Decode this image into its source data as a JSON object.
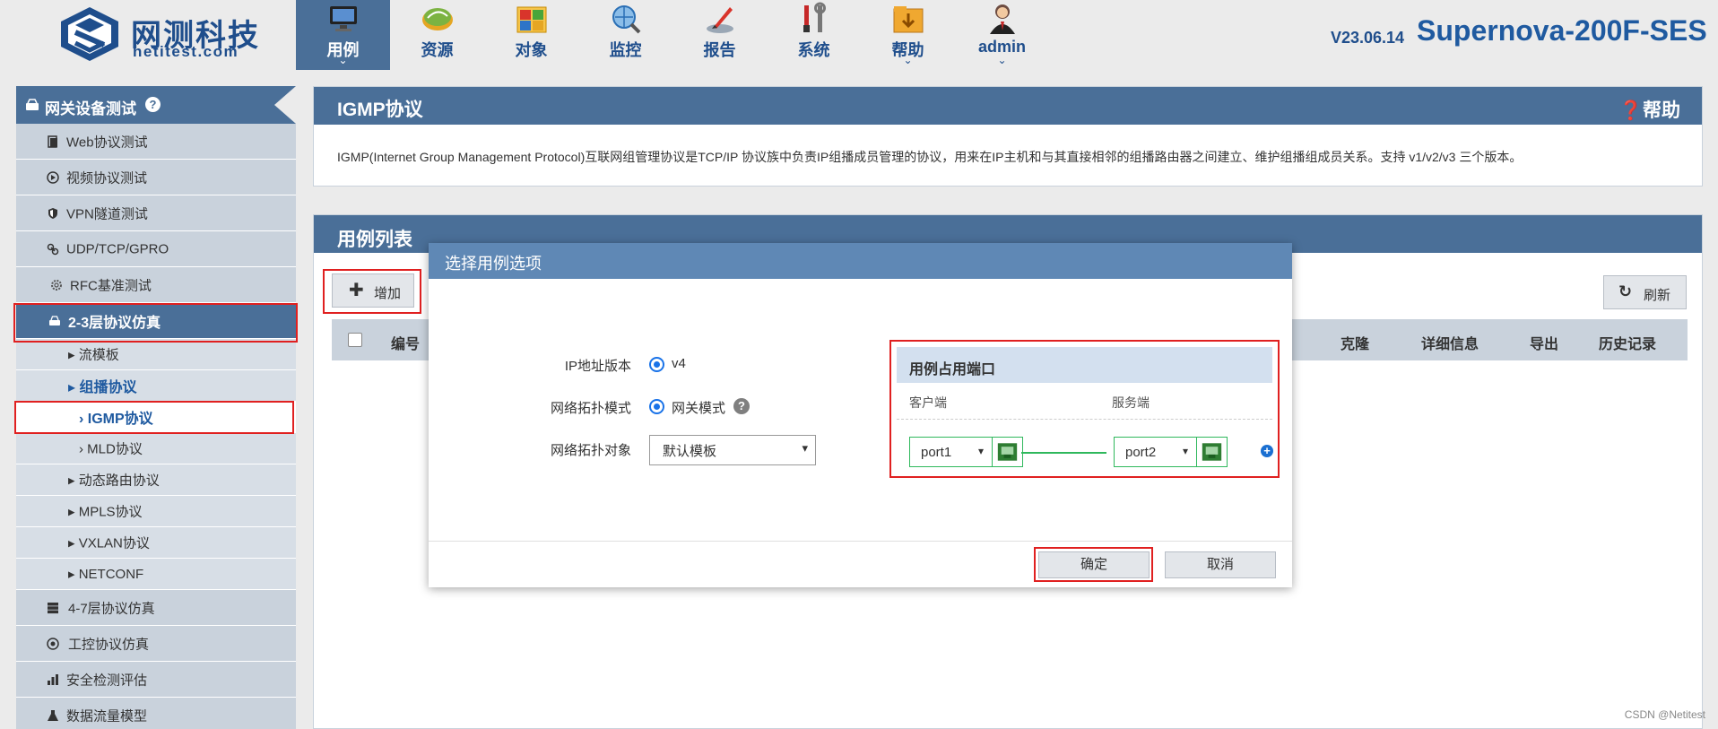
{
  "brand": {
    "name_cn": "网测科技",
    "name_en": "netitest.com"
  },
  "nav": {
    "items": [
      {
        "label": "用例",
        "icon": "monitor-icon",
        "active": true,
        "has_dropdown": true
      },
      {
        "label": "资源",
        "icon": "resource-disc-icon"
      },
      {
        "label": "对象",
        "icon": "object-blocks-icon"
      },
      {
        "label": "监控",
        "icon": "monitor-globe-icon"
      },
      {
        "label": "报告",
        "icon": "report-quill-icon"
      },
      {
        "label": "系统",
        "icon": "tools-icon"
      },
      {
        "label": "帮助",
        "icon": "help-folder-icon",
        "has_dropdown": true
      },
      {
        "label": "admin",
        "icon": "user-icon",
        "has_dropdown": true
      }
    ],
    "chevron": "⌄"
  },
  "header": {
    "version": "V23.06.14",
    "model": "Supernova-200F-SES"
  },
  "sidebar": {
    "title": "网关设备测试",
    "title_help": "?",
    "items": [
      {
        "label": "Web协议测试",
        "kind": "group",
        "icon": "document-icon"
      },
      {
        "label": "视频协议测试",
        "kind": "group",
        "icon": "play-circle-icon"
      },
      {
        "label": "VPN隧道测试",
        "kind": "group",
        "icon": "shield-icon"
      },
      {
        "label": "UDP/TCP/GPRO",
        "kind": "group",
        "icon": "link-icon"
      },
      {
        "label": "RFC基准测试",
        "kind": "group",
        "icon": "gear-icon"
      },
      {
        "label": "2-3层协议仿真",
        "kind": "group",
        "icon": "drive-icon",
        "selected": true
      },
      {
        "label": "▸ 流模板",
        "kind": "sub"
      },
      {
        "label": "▸ 组播协议",
        "kind": "sub",
        "highlight": true
      },
      {
        "label": "› IGMP协议",
        "kind": "sub",
        "selected": true
      },
      {
        "label": "› MLD协议",
        "kind": "sub"
      },
      {
        "label": "▸ 动态路由协议",
        "kind": "sub"
      },
      {
        "label": "▸ MPLS协议",
        "kind": "sub"
      },
      {
        "label": "▸ VXLAN协议",
        "kind": "sub"
      },
      {
        "label": "▸ NETCONF",
        "kind": "sub"
      },
      {
        "label": "4-7层协议仿真",
        "kind": "group",
        "icon": "server-icon"
      },
      {
        "label": "工控协议仿真",
        "kind": "group",
        "icon": "target-icon"
      },
      {
        "label": "安全检测评估",
        "kind": "group",
        "icon": "bar-chart-icon"
      },
      {
        "label": "数据流量模型",
        "kind": "group",
        "icon": "flask-icon"
      }
    ]
  },
  "protocol_panel": {
    "title": "IGMP协议",
    "help_label": "❓帮助",
    "description": "IGMP(Internet Group Management Protocol)互联网组管理协议是TCP/IP 协议族中负责IP组播成员管理的协议，用来在IP主机和与其直接相邻的组播路由器之间建立、维护组播组成员关系。支持 v1/v2/v3 三个版本。"
  },
  "case_list": {
    "title": "用例列表",
    "add_label": "增加",
    "add_icon": "plus-icon",
    "refresh_label": "刷新",
    "refresh_icon": "refresh-icon",
    "columns_visible": [
      "编号",
      "克隆",
      "详细信息",
      "导出",
      "历史记录"
    ]
  },
  "dialog": {
    "title": "选择用例选项",
    "fields": {
      "ip_version_label": "IP地址版本",
      "ip_version_value": "v4",
      "topology_mode_label": "网络拓扑模式",
      "topology_mode_value": "网关模式",
      "topology_object_label": "网络拓扑对象",
      "topology_object_value": "默认模板"
    },
    "ports": {
      "title": "用例占用端口",
      "client_label": "客户端",
      "server_label": "服务端",
      "client_port": "port1",
      "server_port": "port2",
      "add_icon": "plus-circle-icon"
    },
    "ok_label": "确定",
    "cancel_label": "取消"
  },
  "watermark": "CSDN @Netitest",
  "colors": {
    "nav_active": "#4a6f98",
    "brand_blue": "#1f4e8c",
    "highlight_red": "#e02020",
    "port_green": "#2fb85c",
    "dialog_head": "#5f88b5"
  }
}
